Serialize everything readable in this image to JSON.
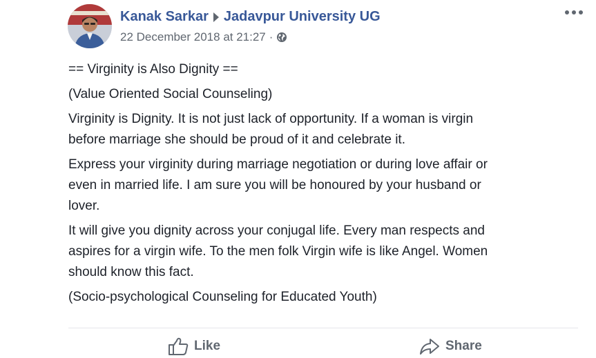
{
  "post": {
    "author_name": "Kanak Sarkar",
    "group_name": "Jadavpur University UG",
    "timestamp": "22 December 2018 at 21:27",
    "separator": "·",
    "privacy_icon": "globe-icon",
    "more_icon": "more-options-icon",
    "paragraphs": [
      "== Virginity is Also Dignity ==",
      "(Value Oriented Social Counseling)",
      "Virginity is Dignity. It is not just lack of opportunity. If a woman is virgin\nbefore marriage she should be proud of it and celebrate it.",
      "Express your virginity during marriage negotiation or during love affair or\neven in married life. I am sure you will be honoured by your husband or\nlover.",
      "It will give you dignity across your conjugal life. Every man respects and\naspires for a virgin wife. To the men folk Virgin wife is like Angel. Women\nshould know this fact.",
      "(Socio-psychological Counseling for Educated Youth)"
    ]
  },
  "actions": {
    "like_label": "Like",
    "like_icon": "thumbs-up-icon",
    "share_label": "Share",
    "share_icon": "share-arrow-icon"
  },
  "colors": {
    "link_blue": "#385898",
    "meta_gray": "#606770",
    "text": "#1d2129",
    "divider": "#e5e6eb"
  }
}
